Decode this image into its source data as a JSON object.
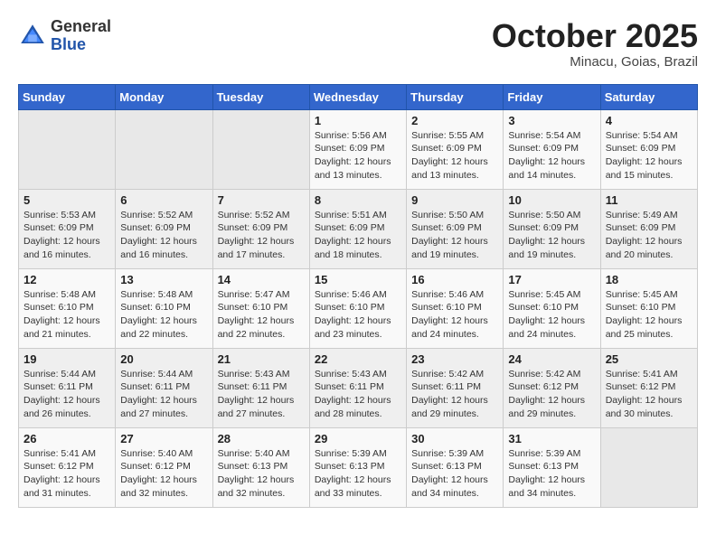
{
  "header": {
    "logo_general": "General",
    "logo_blue": "Blue",
    "month_title": "October 2025",
    "subtitle": "Minacu, Goias, Brazil"
  },
  "weekdays": [
    "Sunday",
    "Monday",
    "Tuesday",
    "Wednesday",
    "Thursday",
    "Friday",
    "Saturday"
  ],
  "weeks": [
    [
      {
        "day": "",
        "info": ""
      },
      {
        "day": "",
        "info": ""
      },
      {
        "day": "",
        "info": ""
      },
      {
        "day": "1",
        "info": "Sunrise: 5:56 AM\nSunset: 6:09 PM\nDaylight: 12 hours and 13 minutes."
      },
      {
        "day": "2",
        "info": "Sunrise: 5:55 AM\nSunset: 6:09 PM\nDaylight: 12 hours and 13 minutes."
      },
      {
        "day": "3",
        "info": "Sunrise: 5:54 AM\nSunset: 6:09 PM\nDaylight: 12 hours and 14 minutes."
      },
      {
        "day": "4",
        "info": "Sunrise: 5:54 AM\nSunset: 6:09 PM\nDaylight: 12 hours and 15 minutes."
      }
    ],
    [
      {
        "day": "5",
        "info": "Sunrise: 5:53 AM\nSunset: 6:09 PM\nDaylight: 12 hours and 16 minutes."
      },
      {
        "day": "6",
        "info": "Sunrise: 5:52 AM\nSunset: 6:09 PM\nDaylight: 12 hours and 16 minutes."
      },
      {
        "day": "7",
        "info": "Sunrise: 5:52 AM\nSunset: 6:09 PM\nDaylight: 12 hours and 17 minutes."
      },
      {
        "day": "8",
        "info": "Sunrise: 5:51 AM\nSunset: 6:09 PM\nDaylight: 12 hours and 18 minutes."
      },
      {
        "day": "9",
        "info": "Sunrise: 5:50 AM\nSunset: 6:09 PM\nDaylight: 12 hours and 19 minutes."
      },
      {
        "day": "10",
        "info": "Sunrise: 5:50 AM\nSunset: 6:09 PM\nDaylight: 12 hours and 19 minutes."
      },
      {
        "day": "11",
        "info": "Sunrise: 5:49 AM\nSunset: 6:09 PM\nDaylight: 12 hours and 20 minutes."
      }
    ],
    [
      {
        "day": "12",
        "info": "Sunrise: 5:48 AM\nSunset: 6:10 PM\nDaylight: 12 hours and 21 minutes."
      },
      {
        "day": "13",
        "info": "Sunrise: 5:48 AM\nSunset: 6:10 PM\nDaylight: 12 hours and 22 minutes."
      },
      {
        "day": "14",
        "info": "Sunrise: 5:47 AM\nSunset: 6:10 PM\nDaylight: 12 hours and 22 minutes."
      },
      {
        "day": "15",
        "info": "Sunrise: 5:46 AM\nSunset: 6:10 PM\nDaylight: 12 hours and 23 minutes."
      },
      {
        "day": "16",
        "info": "Sunrise: 5:46 AM\nSunset: 6:10 PM\nDaylight: 12 hours and 24 minutes."
      },
      {
        "day": "17",
        "info": "Sunrise: 5:45 AM\nSunset: 6:10 PM\nDaylight: 12 hours and 24 minutes."
      },
      {
        "day": "18",
        "info": "Sunrise: 5:45 AM\nSunset: 6:10 PM\nDaylight: 12 hours and 25 minutes."
      }
    ],
    [
      {
        "day": "19",
        "info": "Sunrise: 5:44 AM\nSunset: 6:11 PM\nDaylight: 12 hours and 26 minutes."
      },
      {
        "day": "20",
        "info": "Sunrise: 5:44 AM\nSunset: 6:11 PM\nDaylight: 12 hours and 27 minutes."
      },
      {
        "day": "21",
        "info": "Sunrise: 5:43 AM\nSunset: 6:11 PM\nDaylight: 12 hours and 27 minutes."
      },
      {
        "day": "22",
        "info": "Sunrise: 5:43 AM\nSunset: 6:11 PM\nDaylight: 12 hours and 28 minutes."
      },
      {
        "day": "23",
        "info": "Sunrise: 5:42 AM\nSunset: 6:11 PM\nDaylight: 12 hours and 29 minutes."
      },
      {
        "day": "24",
        "info": "Sunrise: 5:42 AM\nSunset: 6:12 PM\nDaylight: 12 hours and 29 minutes."
      },
      {
        "day": "25",
        "info": "Sunrise: 5:41 AM\nSunset: 6:12 PM\nDaylight: 12 hours and 30 minutes."
      }
    ],
    [
      {
        "day": "26",
        "info": "Sunrise: 5:41 AM\nSunset: 6:12 PM\nDaylight: 12 hours and 31 minutes."
      },
      {
        "day": "27",
        "info": "Sunrise: 5:40 AM\nSunset: 6:12 PM\nDaylight: 12 hours and 32 minutes."
      },
      {
        "day": "28",
        "info": "Sunrise: 5:40 AM\nSunset: 6:13 PM\nDaylight: 12 hours and 32 minutes."
      },
      {
        "day": "29",
        "info": "Sunrise: 5:39 AM\nSunset: 6:13 PM\nDaylight: 12 hours and 33 minutes."
      },
      {
        "day": "30",
        "info": "Sunrise: 5:39 AM\nSunset: 6:13 PM\nDaylight: 12 hours and 34 minutes."
      },
      {
        "day": "31",
        "info": "Sunrise: 5:39 AM\nSunset: 6:13 PM\nDaylight: 12 hours and 34 minutes."
      },
      {
        "day": "",
        "info": ""
      }
    ]
  ]
}
